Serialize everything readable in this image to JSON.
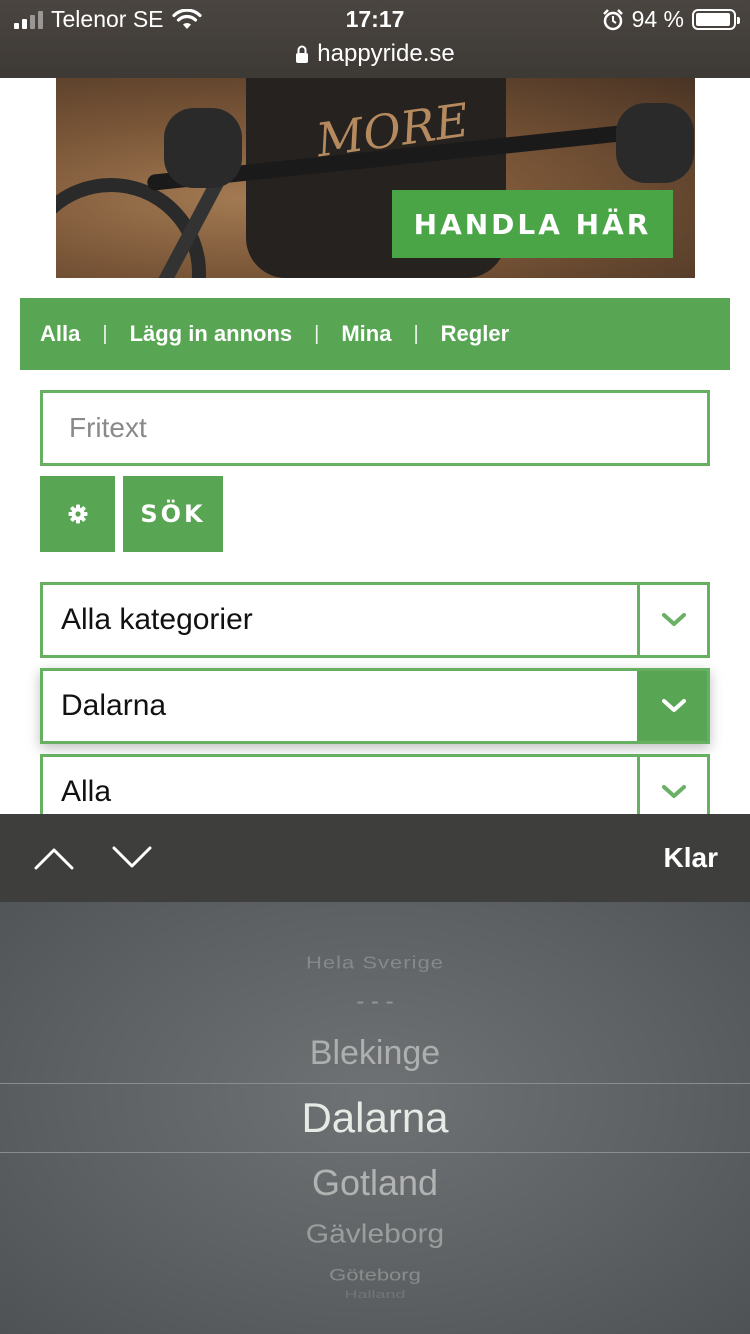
{
  "status": {
    "carrier": "Telenor SE",
    "time": "17:17",
    "battery": "94 %",
    "battery_level": 0.94,
    "url": "happyride.se"
  },
  "banner": {
    "shirt_text": "MORE",
    "cta": "HANDLA HÄR"
  },
  "nav": {
    "items": [
      "Alla",
      "Lägg in annons",
      "Mina",
      "Regler"
    ]
  },
  "search": {
    "placeholder": "Fritext",
    "button_label": "SÖK"
  },
  "selects": [
    {
      "value": "Alla kategorier"
    },
    {
      "value": "Dalarna"
    },
    {
      "value": "Alla"
    }
  ],
  "toolbar": {
    "done_label": "Klar"
  },
  "picker": {
    "options": [
      "Hela Sverige",
      "- - -",
      "Blekinge",
      "Dalarna",
      "Gotland",
      "Gävleborg",
      "Göteborg",
      "Halland"
    ],
    "selected": "Dalarna"
  },
  "colors": {
    "brand_green": "#58a553",
    "status_bar": "#3d3935",
    "picker_bg": "#5e6163"
  }
}
